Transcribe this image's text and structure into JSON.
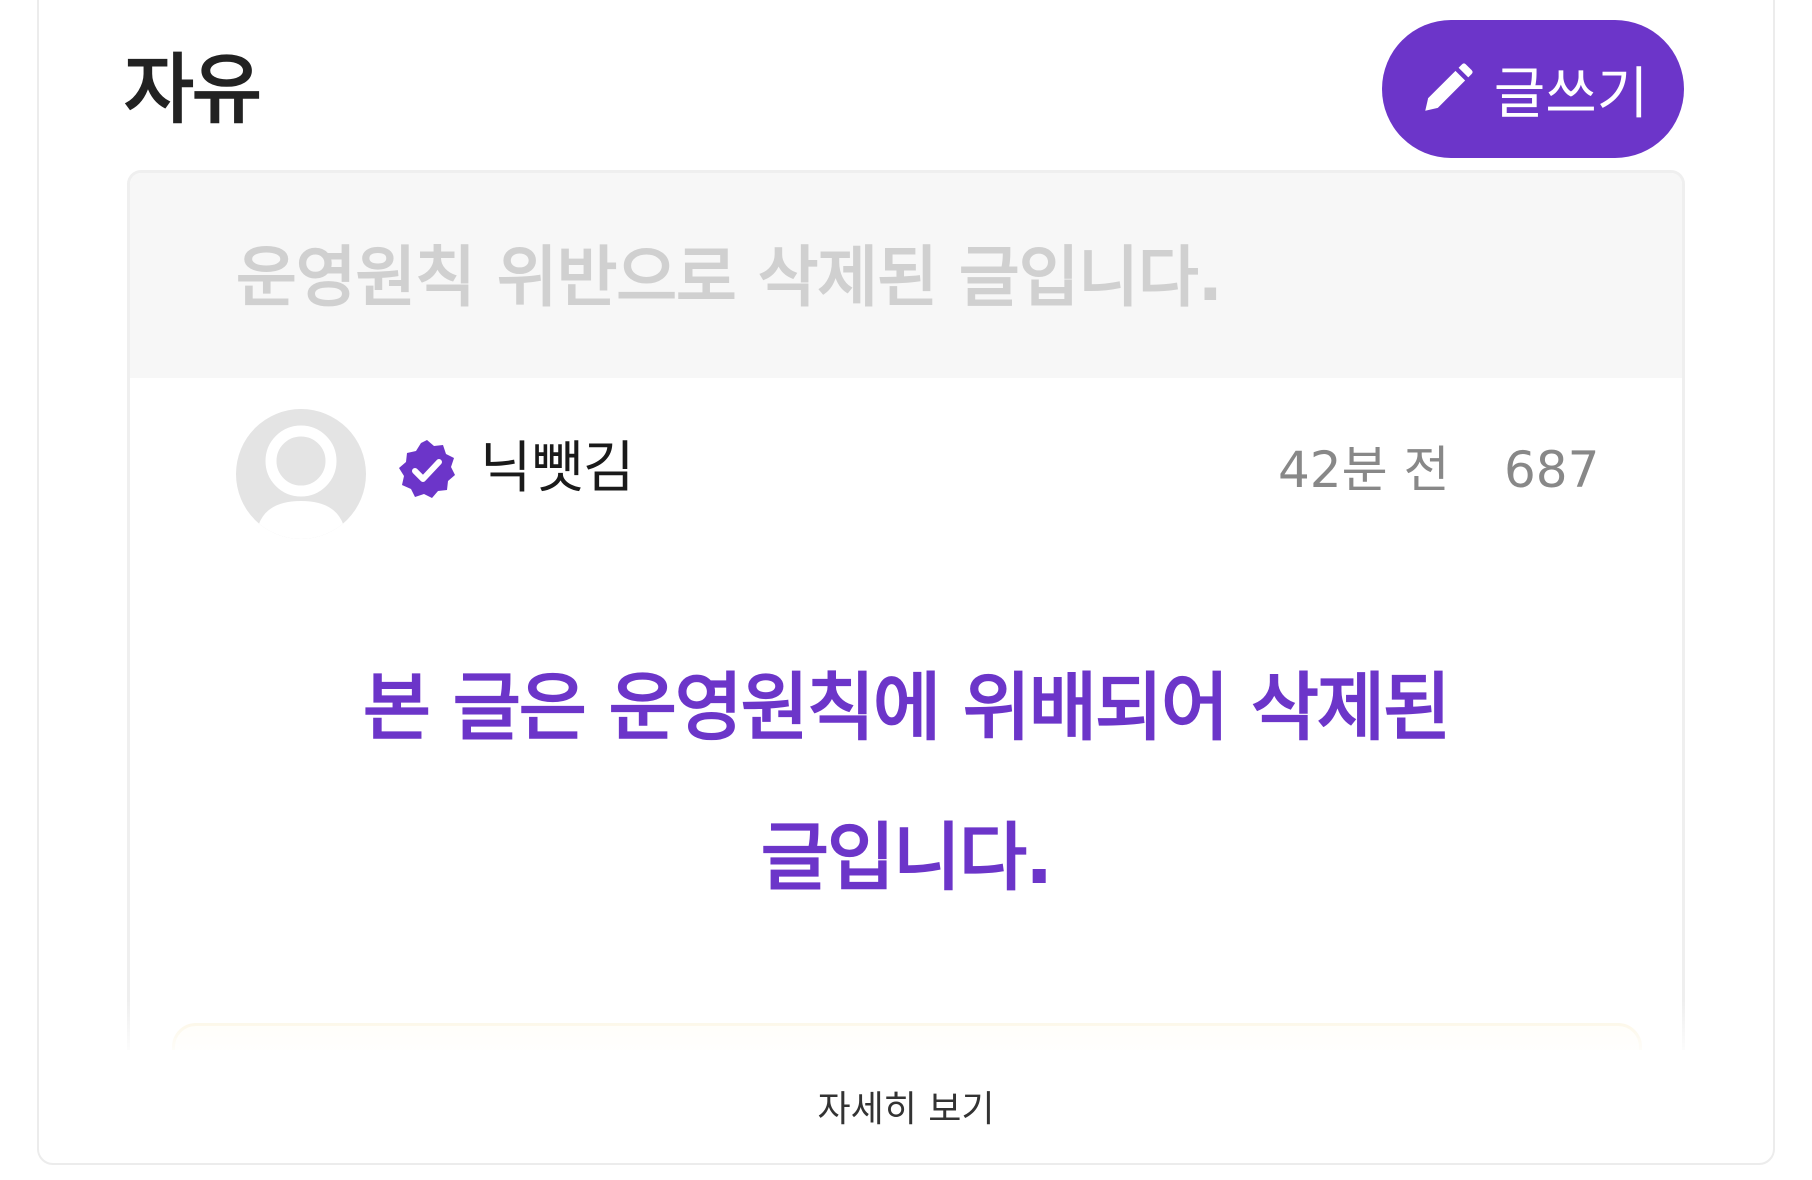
{
  "board": {
    "title": "자유"
  },
  "toolbar": {
    "write_label": "글쓰기",
    "write_icon": "pencil-icon"
  },
  "post": {
    "title": "운영원칙 위반으로 삭제된 글입니다.",
    "author": "닉뺏김",
    "verified_icon": "verified-badge-icon",
    "time": "42분 전",
    "views": "687",
    "notice_line1": "본 글은 운영원칙에 위배되어 삭제된",
    "notice_line2": "글입니다."
  },
  "footer": {
    "more_label": "자세히 보기"
  },
  "colors": {
    "accent": "#6c35c9",
    "muted": "#888888",
    "title_muted": "#d0d0d0"
  }
}
